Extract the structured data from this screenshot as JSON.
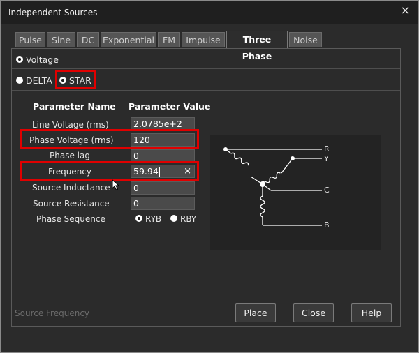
{
  "window": {
    "title": "Independent Sources",
    "close_glyph": "×"
  },
  "tabs": [
    {
      "label": "Pulse"
    },
    {
      "label": "Sine"
    },
    {
      "label": "DC"
    },
    {
      "label": "Exponential"
    },
    {
      "label": "FM"
    },
    {
      "label": "Impulse"
    },
    {
      "label": "Three Phase",
      "active": true
    },
    {
      "label": "Noise"
    }
  ],
  "source_type": {
    "label": "Voltage",
    "selected": true
  },
  "connection": {
    "delta_label": "DELTA",
    "star_label": "STAR",
    "selected": "STAR"
  },
  "params": {
    "header_name": "Parameter Name",
    "header_value": "Parameter Value",
    "line_voltage": {
      "label": "Line Voltage (rms)",
      "value": "2.0785e+2"
    },
    "phase_voltage": {
      "label": "Phase Voltage (rms)",
      "value": "120"
    },
    "phase_lag": {
      "label": "Phase lag",
      "value": "0"
    },
    "frequency": {
      "label": "Frequency",
      "value": "59.94",
      "clear_glyph": "×"
    },
    "source_inductance": {
      "label": "Source Inductance",
      "value": "0"
    },
    "source_resistance": {
      "label": "Source Resistance",
      "value": "0"
    },
    "phase_sequence": {
      "label": "Phase Sequence",
      "options": [
        "RYB",
        "RBY"
      ],
      "selected": "RYB"
    }
  },
  "diagram": {
    "labels": {
      "r": "R",
      "y": "Y",
      "c": "C",
      "b": "B"
    }
  },
  "status_text": "Source Frequency",
  "buttons": {
    "place": "Place",
    "close": "Close",
    "help": "Help"
  },
  "colors": {
    "highlight": "#e00000",
    "background": "#2b2b2b",
    "titlebar": "#1f1f1f"
  }
}
